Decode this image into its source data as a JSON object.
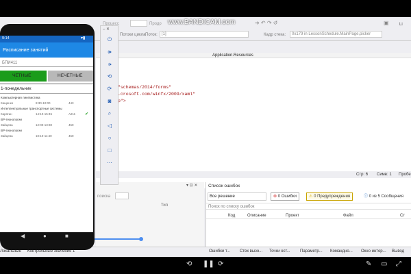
{
  "watermark": "www.BANDICAM.com",
  "vs": {
    "toolbar_items": [
      "Продо",
      "Процесс",
      "Потоки цикла",
      "Поток:",
      "[1]",
      "Кадр стека:",
      "0x179 in LessonSchedule.MainPage.picker"
    ],
    "editor_tab": "Application.Resources",
    "code_lines": [
      "\"schemas/2014/forms\"",
      ".crosoft.com/winfx/2009/xaml\"",
      "p\">"
    ],
    "status": {
      "line": "Стр: 6",
      "char": "Симв: 1",
      "spaces": "Пробе"
    },
    "left_panel": {
      "search": "поиска",
      "column": "Тип"
    },
    "error_list": {
      "title": "Список ошибок",
      "scope": "Все решение",
      "errors_btn": "0 Ошибки",
      "warnings_btn": "0 Предупреждения",
      "messages_btn": "0 из 5 Сообщения",
      "search_placeholder": "Поиск по списку ошибок",
      "columns": [
        "Код",
        "Описание",
        "Проект",
        "Файл",
        "Ст"
      ]
    },
    "bottom_tabs_left": [
      "Локальные",
      "Контрольные значения 1"
    ],
    "bottom_tabs_right": [
      "Ошибки т...",
      "Стек вызо...",
      "Точки ост...",
      "Параметр...",
      "Командно...",
      "Окно интер...",
      "Вывод"
    ]
  },
  "phone": {
    "time": "9:14",
    "app_title": "Расписание занятий",
    "group": "БПИ411",
    "btn_even": "ЧЕТНЫЕ",
    "btn_odd": "НЕЧЕТНЫЕ",
    "day": "1-понедельник",
    "lessons": [
      {
        "subject": "Компьютерная лингвистика",
        "teacher": "Кищенко",
        "time": "8:30-10:00",
        "room": "443",
        "check": ""
      },
      {
        "subject": "Интеллектуальные транспортные системы",
        "teacher": "Карягин",
        "time": "14:10-15:45",
        "room": "А211",
        "check": "✔"
      },
      {
        "subject": "ВР-технологии",
        "teacher": "Зайцева",
        "time": "12:00-13:30",
        "room": "450",
        "check": ""
      },
      {
        "subject": "ВР-технологии",
        "teacher": "Зайцева",
        "time": "10:10-11:40",
        "room": "450",
        "check": ""
      }
    ]
  },
  "emulator": {
    "buttons": [
      "power-icon",
      "volume-up-icon",
      "volume-down-icon",
      "rotate-left-icon",
      "rotate-right-icon",
      "camera-icon",
      "zoom-icon",
      "back-icon",
      "home-icon",
      "overview-icon",
      "more-icon"
    ]
  },
  "colors": {
    "accent": "#1e88e5",
    "even_btn": "#1b9c1b",
    "odd_btn": "#b8b8b8"
  }
}
